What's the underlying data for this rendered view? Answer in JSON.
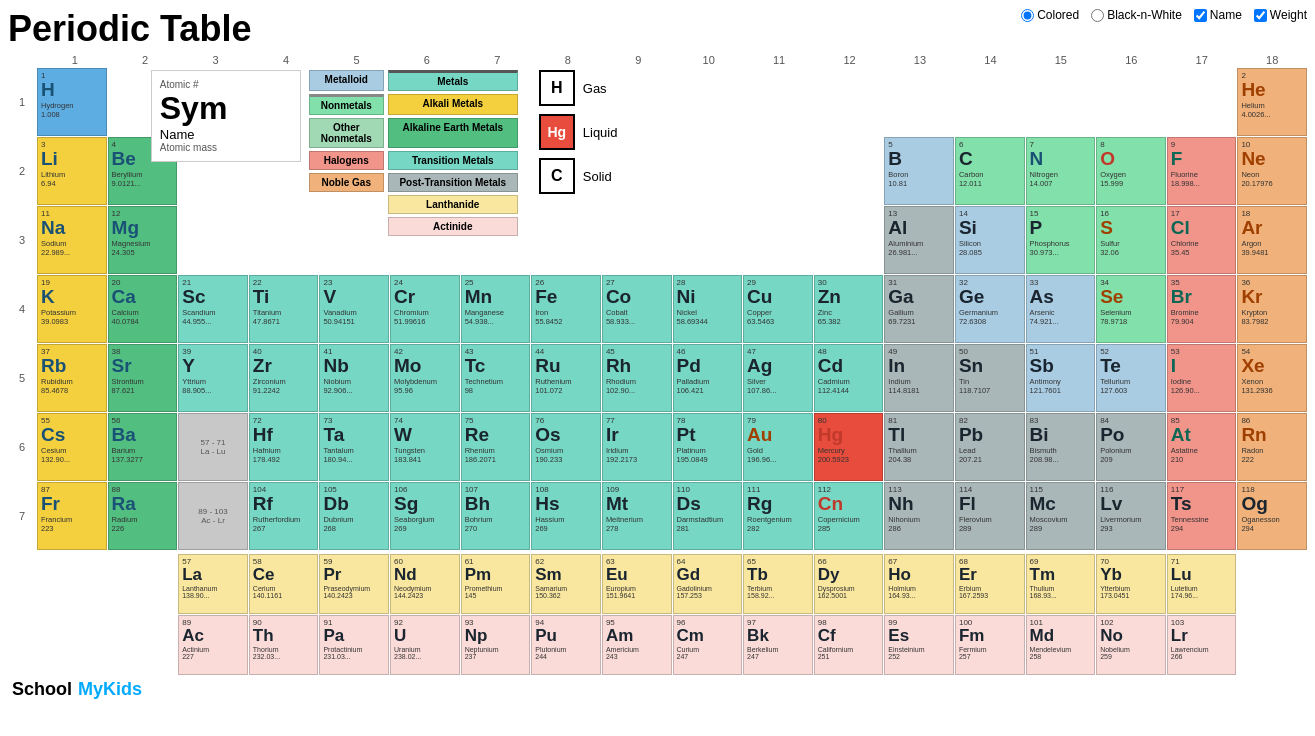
{
  "title": "Periodic Table",
  "controls": {
    "colored_label": "Colored",
    "bnw_label": "Black-n-White",
    "name_label": "Name",
    "weight_label": "Weight"
  },
  "legend": {
    "atomic_num": "Atomic #",
    "symbol": "Sym",
    "name": "Name",
    "mass": "Atomic mass"
  },
  "categories": [
    {
      "name": "Metalloid",
      "type": "metalloid"
    },
    {
      "name": "Metals",
      "type": "metals-header"
    },
    {
      "name": "Nonmetals",
      "type": "nonmetals"
    },
    {
      "name": "Alkali Metals",
      "type": "alkali"
    },
    {
      "name": "Other Nonmetals",
      "type": "other-nonmetals"
    },
    {
      "name": "Alkaline Earth Metals",
      "type": "alkaline"
    },
    {
      "name": "Halogens",
      "type": "halogens"
    },
    {
      "name": "Transition Metals",
      "type": "transition"
    },
    {
      "name": "Noble Gas",
      "type": "noble"
    },
    {
      "name": "Post-Transition Metals",
      "type": "post-transition"
    },
    {
      "name": "Lanthanide",
      "type": "lanthanide"
    },
    {
      "name": "Actinide",
      "type": "actinide"
    }
  ],
  "states": [
    {
      "symbol": "H",
      "label": "Gas"
    },
    {
      "symbol": "Hg",
      "label": "Liquid"
    },
    {
      "symbol": "C",
      "label": "Solid"
    }
  ],
  "col_nums": [
    "1",
    "2",
    "3",
    "4",
    "5",
    "6",
    "7",
    "8",
    "9",
    "10",
    "11",
    "12",
    "13",
    "14",
    "15",
    "16",
    "17",
    "18"
  ],
  "row_nums": [
    "1",
    "2",
    "3",
    "4",
    "5",
    "6",
    "7"
  ],
  "footer": {
    "school": "School",
    "mykids": "MyKids"
  }
}
